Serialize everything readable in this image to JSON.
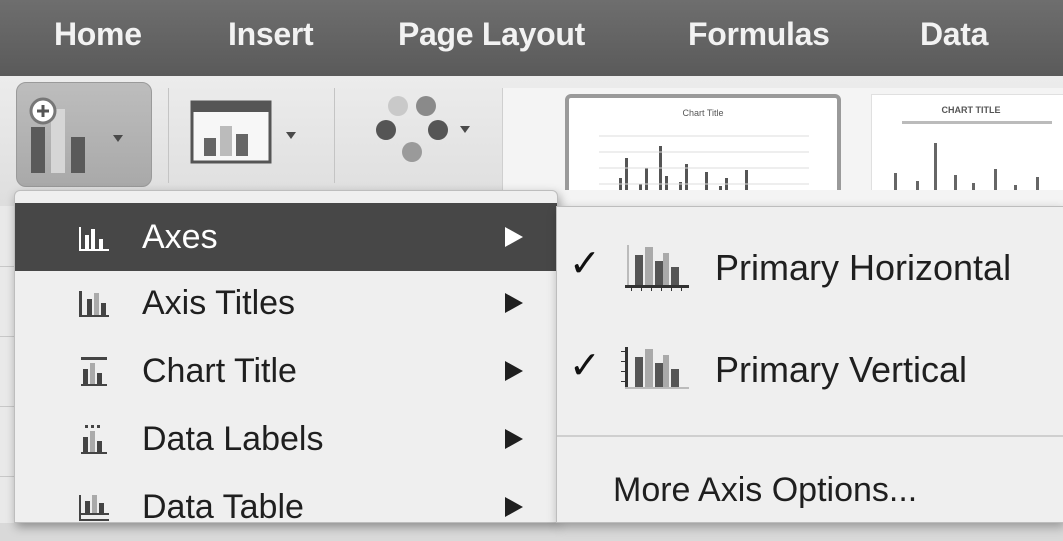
{
  "tabs": [
    {
      "label": "Home"
    },
    {
      "label": "Insert"
    },
    {
      "label": "Page Layout"
    },
    {
      "label": "Formulas"
    },
    {
      "label": "Data"
    }
  ],
  "ribbon": {
    "add_chart_element_icon": "chart-plus-icon",
    "quick_layout_icon": "quick-layout-icon",
    "change_colors_icon": "color-dots-icon",
    "styles": [
      {
        "title": "Chart Title"
      },
      {
        "title": "CHART TITLE"
      }
    ]
  },
  "menu": {
    "items": [
      {
        "label": "Axes",
        "icon": "axes-icon"
      },
      {
        "label": "Axis Titles",
        "icon": "axis-titles-icon"
      },
      {
        "label": "Chart Title",
        "icon": "chart-title-icon"
      },
      {
        "label": "Data Labels",
        "icon": "data-labels-icon"
      },
      {
        "label": "Data Table",
        "icon": "data-table-icon"
      }
    ]
  },
  "submenu": {
    "items": [
      {
        "label": "Primary Horizontal",
        "checked": true,
        "check": "✓",
        "icon": "primary-horizontal-axis-icon"
      },
      {
        "label": "Primary Vertical",
        "checked": true,
        "check": "✓",
        "icon": "primary-vertical-axis-icon"
      }
    ],
    "more_options": "More Axis Options..."
  }
}
